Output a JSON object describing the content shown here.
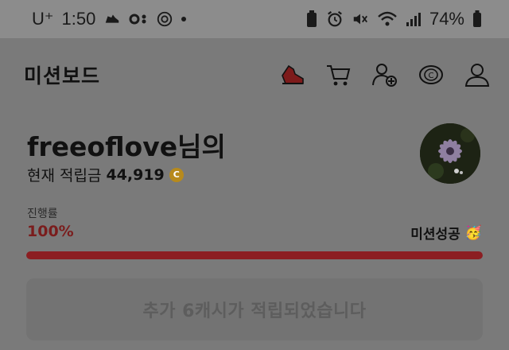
{
  "status_bar": {
    "carrier": "U⁺",
    "time": "1:50",
    "battery_percent": "74%",
    "icons_left": [
      "sneaker-icon",
      "link-icon",
      "flower-icon",
      "dot-icon"
    ],
    "icons_right": [
      "battery-saver-icon",
      "alarm-icon",
      "mute-icon",
      "wifi-icon",
      "signal-icon",
      "battery-icon"
    ]
  },
  "header": {
    "title": "미션보드",
    "icons": [
      "sneaker-icon",
      "cart-icon",
      "add-friend-icon",
      "coin-icon",
      "profile-icon"
    ]
  },
  "profile": {
    "username_line": "freeoflove님의",
    "points_label": "현재 적립금",
    "points_value": "44,919",
    "coin_symbol": "C"
  },
  "progress": {
    "label": "진행률",
    "value_text": "100%",
    "value": 100,
    "status": "미션성공",
    "status_emoji": "🥳"
  },
  "reward": {
    "message": "추가 6캐시가 적립되었습니다"
  },
  "colors": {
    "accent": "#8c1e22",
    "coin": "#b78a1c",
    "overlay_bg": "#7a7a7a"
  }
}
